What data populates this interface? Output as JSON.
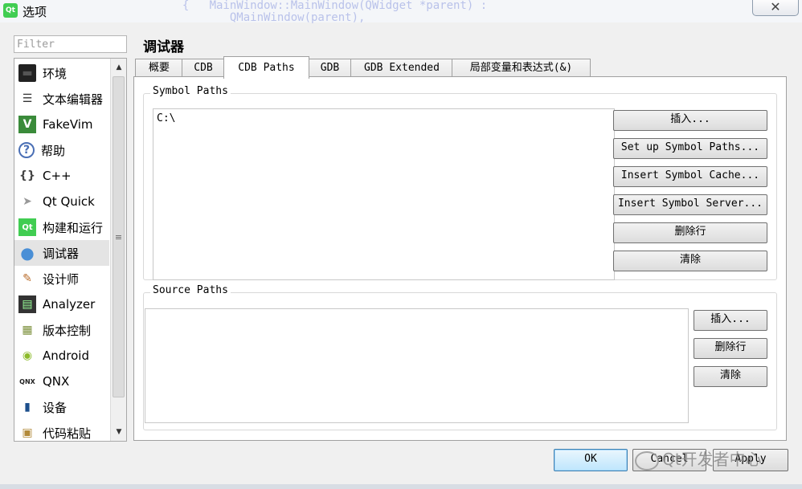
{
  "window": {
    "title": "选项",
    "app_icon_text": "Qt",
    "close_glyph": "✕",
    "background_code": "  {   MainWindow::MainWindow(QWidget *parent) :\n         QMainWindow(parent),"
  },
  "filter": {
    "placeholder": "Filter",
    "value": ""
  },
  "categories": [
    {
      "label": "环境",
      "icon": "monitor-icon"
    },
    {
      "label": "文本编辑器",
      "icon": "text-editor-icon"
    },
    {
      "label": "FakeVim",
      "icon": "fakevim-icon"
    },
    {
      "label": "帮助",
      "icon": "help-icon"
    },
    {
      "label": "C++",
      "icon": "braces-icon"
    },
    {
      "label": "Qt Quick",
      "icon": "paper-plane-icon"
    },
    {
      "label": "构建和运行",
      "icon": "build-run-icon"
    },
    {
      "label": "调试器",
      "icon": "debugger-icon",
      "selected": true
    },
    {
      "label": "设计师",
      "icon": "designer-icon"
    },
    {
      "label": "Analyzer",
      "icon": "analyzer-icon"
    },
    {
      "label": "版本控制",
      "icon": "version-control-icon"
    },
    {
      "label": "Android",
      "icon": "android-icon"
    },
    {
      "label": "QNX",
      "icon": "qnx-icon"
    },
    {
      "label": "设备",
      "icon": "device-icon"
    },
    {
      "label": "代码粘贴",
      "icon": "code-paste-icon"
    }
  ],
  "page_title": "调试器",
  "tabs": [
    {
      "label": "概要"
    },
    {
      "label": "CDB"
    },
    {
      "label": "CDB Paths",
      "active": true
    },
    {
      "label": "GDB"
    },
    {
      "label": "GDB Extended"
    },
    {
      "label": "局部变量和表达式(&)"
    }
  ],
  "symbol_paths": {
    "title": "Symbol Paths",
    "items": [
      "C:\\"
    ],
    "buttons": [
      "插入...",
      "Set up Symbol Paths...",
      "Insert Symbol Cache...",
      "Insert Symbol Server...",
      "删除行",
      "清除"
    ]
  },
  "source_paths": {
    "title": "Source Paths",
    "items": [],
    "buttons": [
      "插入...",
      "删除行",
      "清除"
    ]
  },
  "dialog_buttons": {
    "ok": "OK",
    "cancel": "Cancel",
    "apply": "Apply"
  },
  "watermark": "Qt开发者中心",
  "colors": {
    "selected_item_bg": "#e4e4e4",
    "default_button_border": "#3c7fb1",
    "qt_green": "#41cd52"
  }
}
